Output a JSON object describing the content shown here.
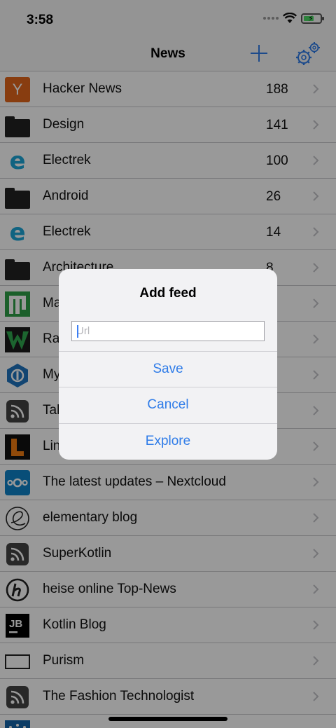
{
  "status": {
    "time": "3:58"
  },
  "nav": {
    "title": "News",
    "add_icon": "plus-icon",
    "settings_icon": "gear-icon"
  },
  "feeds": [
    {
      "label": "Hacker News",
      "count": "188",
      "icon": "hacker-news-icon"
    },
    {
      "label": "Design",
      "count": "141",
      "icon": "folder-icon"
    },
    {
      "label": "Electrek",
      "count": "100",
      "icon": "electrek-icon"
    },
    {
      "label": "Android",
      "count": "26",
      "icon": "folder-icon"
    },
    {
      "label": "Electrek",
      "count": "14",
      "icon": "electrek-icon"
    },
    {
      "label": "Architecture",
      "count": "8",
      "icon": "folder-icon"
    },
    {
      "label": "Ma",
      "count": "",
      "icon": "green-m-icon"
    },
    {
      "label": "Ra",
      "count": "",
      "icon": "green-w-icon"
    },
    {
      "label": "My",
      "count": "",
      "icon": "blue-hexagon-icon"
    },
    {
      "label": "Tal",
      "count": "",
      "icon": "rss-icon"
    },
    {
      "label": "Lin",
      "count": "",
      "icon": "orange-l-icon"
    },
    {
      "label": "The latest updates – Nextcloud",
      "count": "",
      "icon": "nextcloud-icon"
    },
    {
      "label": "elementary blog",
      "count": "",
      "icon": "elementary-icon"
    },
    {
      "label": "SuperKotlin",
      "count": "",
      "icon": "rss-icon"
    },
    {
      "label": "heise online Top-News",
      "count": "",
      "icon": "heise-icon"
    },
    {
      "label": "Kotlin Blog",
      "count": "",
      "icon": "jetbrains-icon"
    },
    {
      "label": "Purism",
      "count": "",
      "icon": "rectangle-icon"
    },
    {
      "label": "The Fashion Technologist",
      "count": "",
      "icon": "rss-icon"
    }
  ],
  "dialog": {
    "title": "Add feed",
    "input_placeholder": "Url",
    "save_label": "Save",
    "cancel_label": "Cancel",
    "explore_label": "Explore"
  },
  "colors": {
    "accent": "#2f7ce8",
    "hacker_news": "#e3661b",
    "electrek": "#1ca5d8",
    "nextcloud": "#0e82c9",
    "battery": "#4cd964"
  }
}
